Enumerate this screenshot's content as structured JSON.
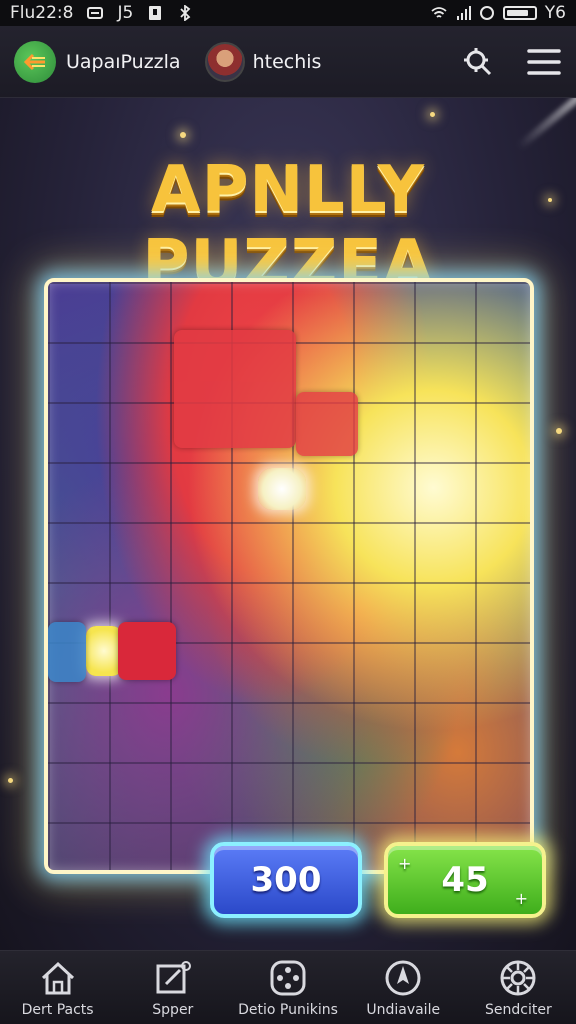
{
  "status_bar": {
    "time": "Flu22:8",
    "left_text": "J5",
    "battery_text": "Y6"
  },
  "header": {
    "app_name": "UapaıPuzzla",
    "user_name": "htechis"
  },
  "game": {
    "title": "APNLLY PUZZEA",
    "score_blue": "300",
    "score_green": "45"
  },
  "bottom_nav": {
    "items": [
      {
        "label": "Dert Pacts",
        "icon": "home-icon"
      },
      {
        "label": "Spper",
        "icon": "edit-icon"
      },
      {
        "label": "Detio Punikins",
        "icon": "dice-icon"
      },
      {
        "label": "Undiavaile",
        "icon": "compass-icon"
      },
      {
        "label": "Sendciter",
        "icon": "settings-wheel-icon"
      }
    ]
  },
  "colors": {
    "title_gold": "#f7c33c",
    "blue_chip": "#2b49c9",
    "green_chip": "#3fae1c",
    "board_glow": "#8cf0ff"
  }
}
